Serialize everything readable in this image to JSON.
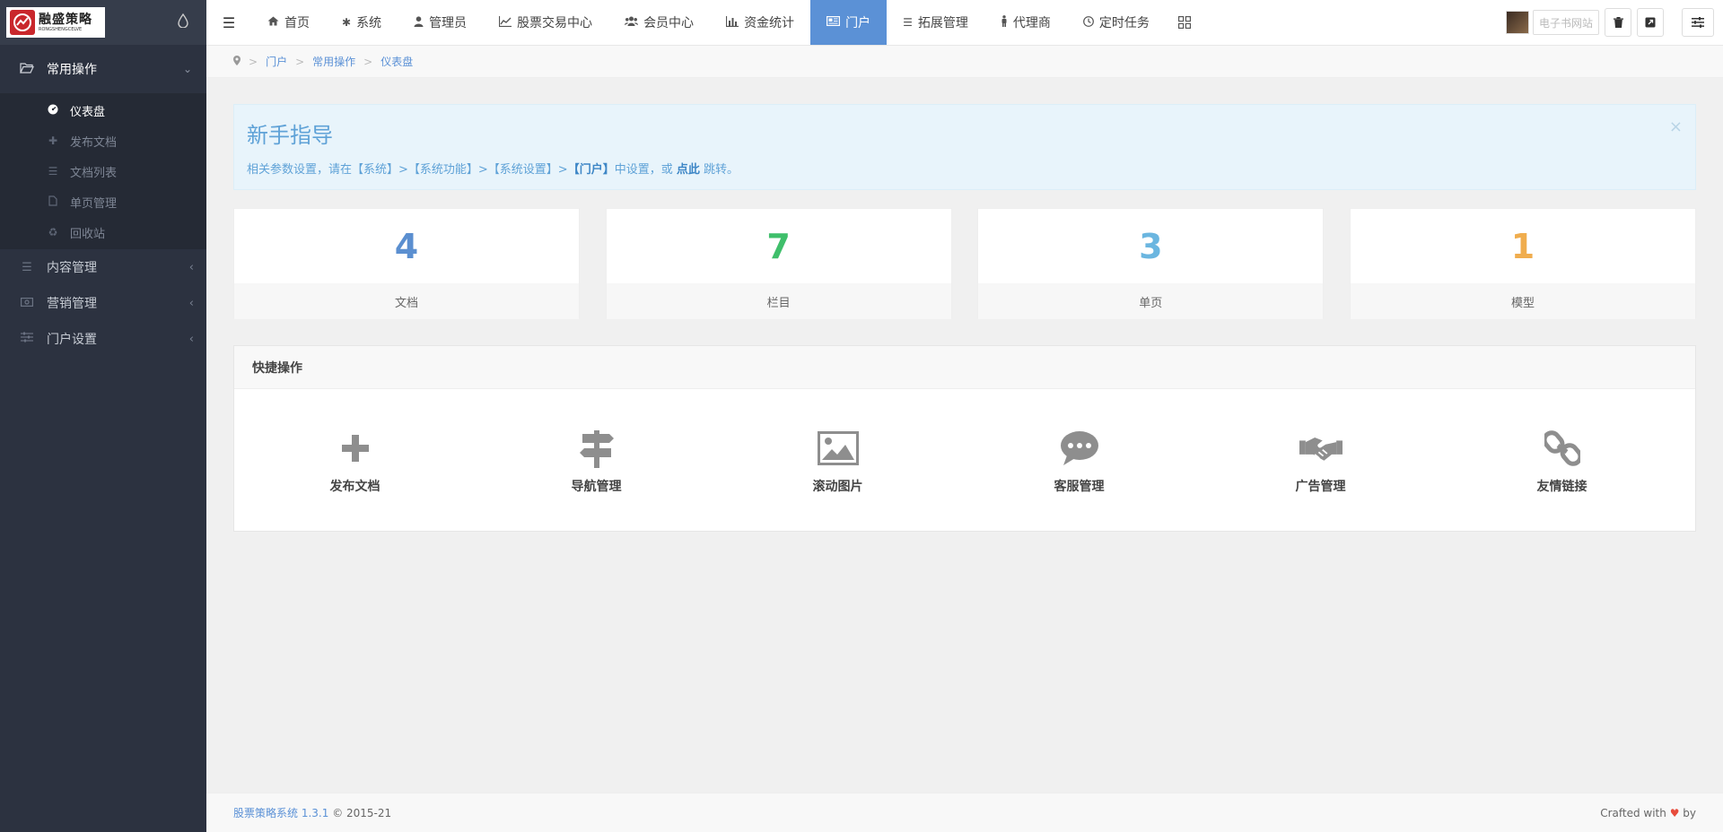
{
  "logo": {
    "cn": "融盛策略",
    "en": "RONGSHENGCELVE"
  },
  "sidebar": {
    "groups": [
      {
        "label": "常用操作",
        "open": true,
        "items": [
          {
            "label": "仪表盘",
            "active": true
          },
          {
            "label": "发布文档"
          },
          {
            "label": "文档列表"
          },
          {
            "label": "单页管理"
          },
          {
            "label": "回收站"
          }
        ]
      },
      {
        "label": "内容管理"
      },
      {
        "label": "营销管理"
      },
      {
        "label": "门户设置"
      }
    ]
  },
  "topnav": {
    "items": [
      {
        "label": "首页"
      },
      {
        "label": "系统"
      },
      {
        "label": "管理员"
      },
      {
        "label": "股票交易中心"
      },
      {
        "label": "会员中心"
      },
      {
        "label": "资金统计"
      },
      {
        "label": "门户",
        "active": true
      },
      {
        "label": "拓展管理"
      },
      {
        "label": "代理商"
      },
      {
        "label": "定时任务"
      }
    ],
    "site_chip": "电子书网站"
  },
  "breadcrumb": [
    "门户",
    "常用操作",
    "仪表盘"
  ],
  "guide": {
    "title": "新手指导",
    "text_before": "相关参数设置，请在【系统】>【系统功能】>【系统设置】>",
    "text_bold1": "【门户】",
    "text_mid": "中设置，或",
    "text_bold2": "点此",
    "text_after": "跳转。",
    "close": "×"
  },
  "stats": [
    {
      "value": "4",
      "label": "文档",
      "color": "#5b8fd0"
    },
    {
      "value": "7",
      "label": "栏目",
      "color": "#3fbf6b"
    },
    {
      "value": "3",
      "label": "单页",
      "color": "#6bb6e0"
    },
    {
      "value": "1",
      "label": "模型",
      "color": "#f0ad4e"
    }
  ],
  "quick": {
    "title": "快捷操作",
    "items": [
      {
        "label": "发布文档",
        "icon": "plus-icon"
      },
      {
        "label": "导航管理",
        "icon": "signpost-icon"
      },
      {
        "label": "滚动图片",
        "icon": "image-icon"
      },
      {
        "label": "客服管理",
        "icon": "chat-icon"
      },
      {
        "label": "广告管理",
        "icon": "handshake-icon"
      },
      {
        "label": "友情链接",
        "icon": "link-icon"
      }
    ]
  },
  "footer": {
    "brand": "股票策略系统 1.3.1",
    "copyright": "© 2015-21",
    "crafted_before": "Crafted with",
    "heart": "♥",
    "crafted_after": "by"
  }
}
